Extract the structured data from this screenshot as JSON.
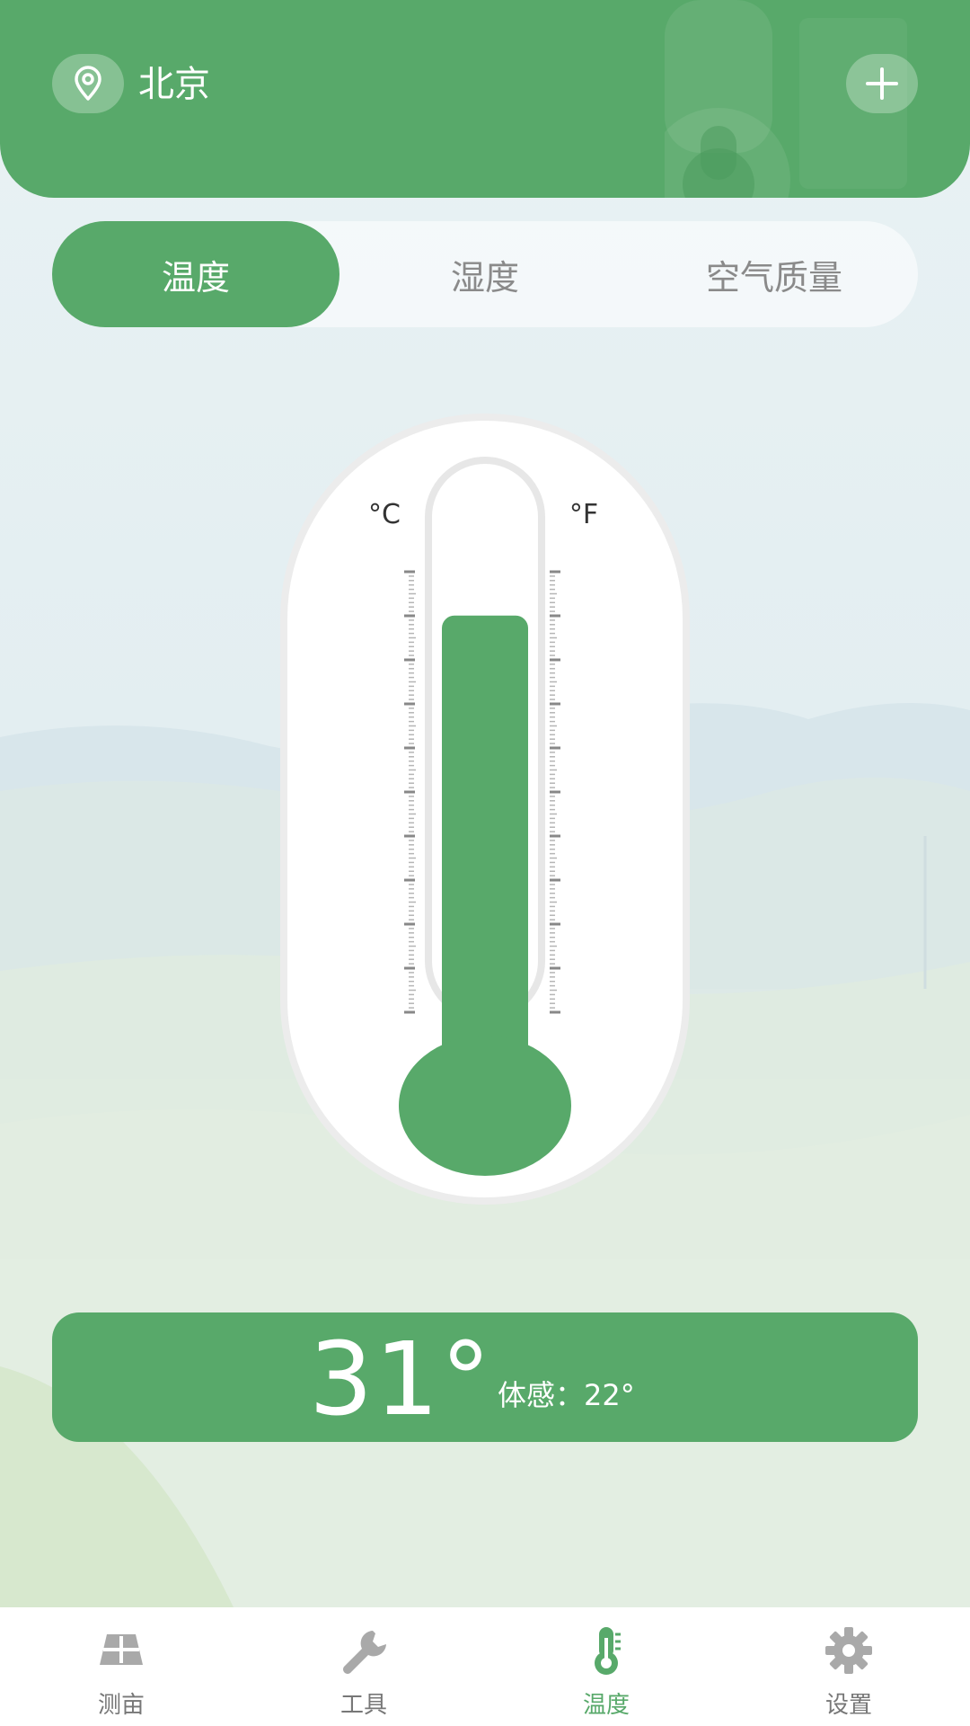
{
  "header": {
    "city": "北京"
  },
  "tabs": [
    {
      "label": "温度",
      "active": true
    },
    {
      "label": "湿度",
      "active": false
    },
    {
      "label": "空气质量",
      "active": false
    }
  ],
  "thermometer": {
    "unit_left": "°C",
    "unit_right": "°F",
    "fill_fraction": 0.82
  },
  "reading": {
    "temperature": "31°",
    "feels_like": "体感：22°"
  },
  "nav": [
    {
      "label": "测亩",
      "icon": "field-grid-icon",
      "active": false
    },
    {
      "label": "工具",
      "icon": "wrench-icon",
      "active": false
    },
    {
      "label": "温度",
      "icon": "thermometer-icon",
      "active": true
    },
    {
      "label": "设置",
      "icon": "gear-icon",
      "active": false
    }
  ],
  "colors": {
    "accent": "#58a96a",
    "inactive": "#8a8a8a"
  }
}
